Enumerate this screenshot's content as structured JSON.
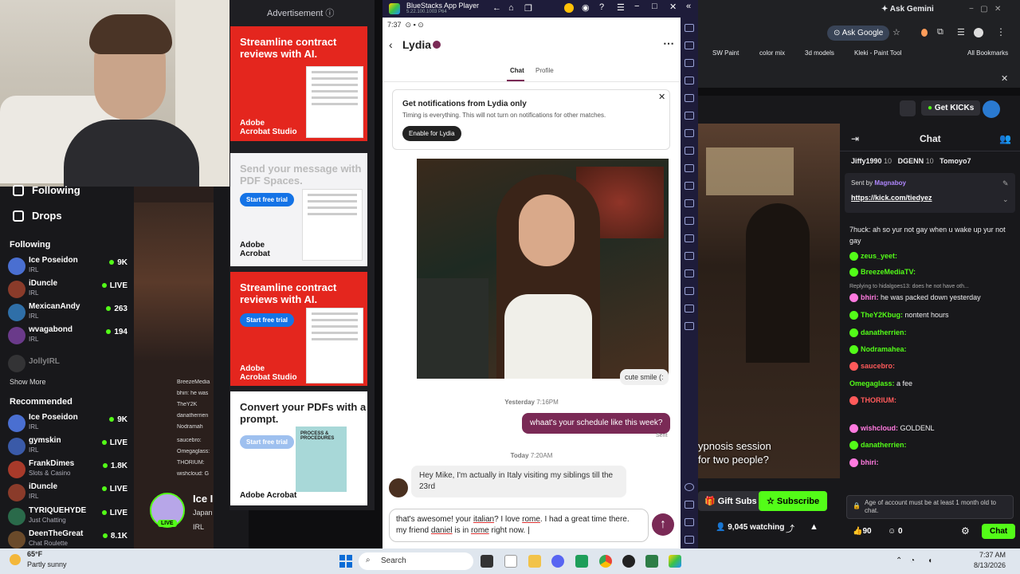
{
  "left": {
    "nav": [
      {
        "label": "Following"
      },
      {
        "label": "Drops"
      }
    ],
    "following_header": "Following",
    "following": [
      {
        "name": "Ice Poseidon",
        "category": "IRL",
        "viewers": "9K",
        "color": "#4a6fd1"
      },
      {
        "name": "iDuncle",
        "category": "IRL",
        "viewers": "LIVE",
        "color": "#8a3b2a"
      },
      {
        "name": "MexicanAndy",
        "category": "IRL",
        "viewers": "263",
        "color": "#2f6fa8"
      },
      {
        "name": "wvagabond",
        "category": "IRL",
        "viewers": "194",
        "color": "#6a3a8a"
      },
      {
        "name": "JollyIRL",
        "category": "",
        "viewers": "",
        "color": "#555"
      }
    ],
    "show_more": "Show More",
    "recommended_header": "Recommended",
    "recommended": [
      {
        "name": "Ice Poseidon",
        "category": "IRL",
        "viewers": "9K",
        "color": "#4a6fd1"
      },
      {
        "name": "gymskin",
        "category": "IRL",
        "viewers": "LIVE",
        "color": "#3a5aa8"
      },
      {
        "name": "FrankDimes",
        "category": "Slots & Casino",
        "viewers": "1.8K",
        "color": "#a83a2a"
      },
      {
        "name": "iDuncle",
        "category": "IRL",
        "viewers": "LIVE",
        "color": "#8a3b2a"
      },
      {
        "name": "TYRIQUEHYDE",
        "category": "Just Chatting",
        "viewers": "LIVE",
        "color": "#2a6a4a"
      },
      {
        "name": "DeenTheGreat",
        "category": "Chat Roulette",
        "viewers": "8.1K",
        "color": "#6a4a2a"
      }
    ],
    "mini_chat": [
      "BreezeMedia",
      "bhiri: he was",
      "TheY2K",
      "danatherrien",
      "Nodramah",
      "saucebro:",
      "Omegaglass:",
      "THORIUM:",
      "wishcloud: G"
    ],
    "pip": {
      "name": "Ice I",
      "sub": "Japan",
      "cat": "IRL",
      "live": "LIVE"
    }
  },
  "ads": {
    "label": "Advertisement",
    "items": [
      {
        "headline": "Streamline contract reviews with AI.",
        "brand": "Adobe\nAcrobat Studio"
      },
      {
        "headline": "Send your message with PDF Spaces.",
        "cta": "Start free trial",
        "brand": "Adobe\nAcrobat"
      },
      {
        "headline": "Streamline contract reviews with AI.",
        "cta": "Start free trial",
        "brand": "Adobe\nAcrobat Studio"
      },
      {
        "headline": "Convert your PDFs with a prompt.",
        "cta": "Start free trial",
        "brand": "Adobe Acrobat",
        "doc": "PROCESS & PROCEDURES"
      }
    ]
  },
  "bluestacks": {
    "title": "BlueStacks App Player",
    "version": "5.22.100.1003  P64",
    "status_time": "7:37",
    "profile_name": "Lydia",
    "tabs": [
      "Chat",
      "Profile"
    ],
    "notification": {
      "title": "Get notifications from Lydia only",
      "body": "Timing is everything. This will not turn on notifications for other matches.",
      "button": "Enable for Lydia"
    },
    "photo_caption": "cute smile (:",
    "messages": [
      {
        "stamp_day": "Yesterday",
        "stamp_time": "7:16PM"
      },
      {
        "text": "whaat's your schedule like this week?",
        "status": "Sent"
      },
      {
        "stamp_day": "Today",
        "stamp_time": "7:20AM"
      },
      {
        "text": "Hey Mike, I'm actually in Italy visiting my siblings till the 23rd"
      }
    ],
    "composer": {
      "text_1": "that's awesome! your ",
      "w1": "italian",
      "text_2": "? I love ",
      "w2": "rome",
      "text_3": ". I had a great time there. my friend ",
      "w3": "daniel",
      "text_4": " is in ",
      "w4": "rome",
      "text_5": " right now. "
    }
  },
  "browser": {
    "ask_gemini": "Ask Gemini",
    "ask_google": "Ask Google",
    "bookmarks": [
      "SW Paint",
      "color mix",
      "3d models",
      "Kleki - Paint Tool"
    ],
    "all_bookmarks": "All Bookmarks"
  },
  "kick": {
    "get_kicks": "Get KICKs",
    "chat_title": "Chat",
    "top_users": [
      "Jiffy1990",
      "10",
      "DGENN",
      "10",
      "Tomoyo7"
    ],
    "pinned": {
      "sent_by": "Sent by",
      "user": "Magnaboy",
      "link": "https://kick.com/tiedyez"
    },
    "messages": [
      {
        "user": "",
        "text": "7huck: ah so yur not gay when u wake up yur not gay",
        "color": "#fff"
      },
      {
        "user": "zeus_yeet:",
        "text": "",
        "color": "#53fc18"
      },
      {
        "user": "BreezeMediaTV:",
        "text": "",
        "color": "#53fc18"
      },
      {
        "user": "",
        "text": "Replying to hidalgoes13: does he not have oth...",
        "color": "#aaa"
      },
      {
        "user": "bhiri:",
        "text": "he was packed down yesterday",
        "color": "#ff7adf"
      },
      {
        "user": "TheY2Kbug:",
        "text": "nontent hours",
        "color": "#53fc18"
      },
      {
        "user": "danatherrien:",
        "text": "",
        "color": "#53fc18"
      },
      {
        "user": "Nodramahea:",
        "text": "",
        "color": "#53fc18"
      },
      {
        "user": "saucebro:",
        "text": "",
        "color": "#ff5a5a"
      },
      {
        "user": "Omegaglass:",
        "text": "a fee",
        "color": "#53fc18"
      },
      {
        "user": "THORIUM:",
        "text": "",
        "color": "#ff5a5a"
      },
      {
        "user": "wishcloud:",
        "text": "GOLDENL",
        "color": "#ff7adf"
      },
      {
        "user": "danatherrien:",
        "text": "",
        "color": "#53fc18"
      },
      {
        "user": "bhiri:",
        "text": "",
        "color": "#ff7adf"
      }
    ],
    "stream_caption": "ypnosis session\nfor two people?",
    "gift_subs": "Gift Subs",
    "subscribe": "Subscribe",
    "watching": "9,045 watching",
    "chat_notice": "Age of account must be at least 1 month old to chat.",
    "likes": "90",
    "dislikes": "0",
    "chat_button": "Chat"
  },
  "taskbar": {
    "weather_temp": "65°F",
    "weather_desc": "Partly sunny",
    "search": "Search",
    "time": "7:37 AM",
    "date": "8/13/2026"
  }
}
